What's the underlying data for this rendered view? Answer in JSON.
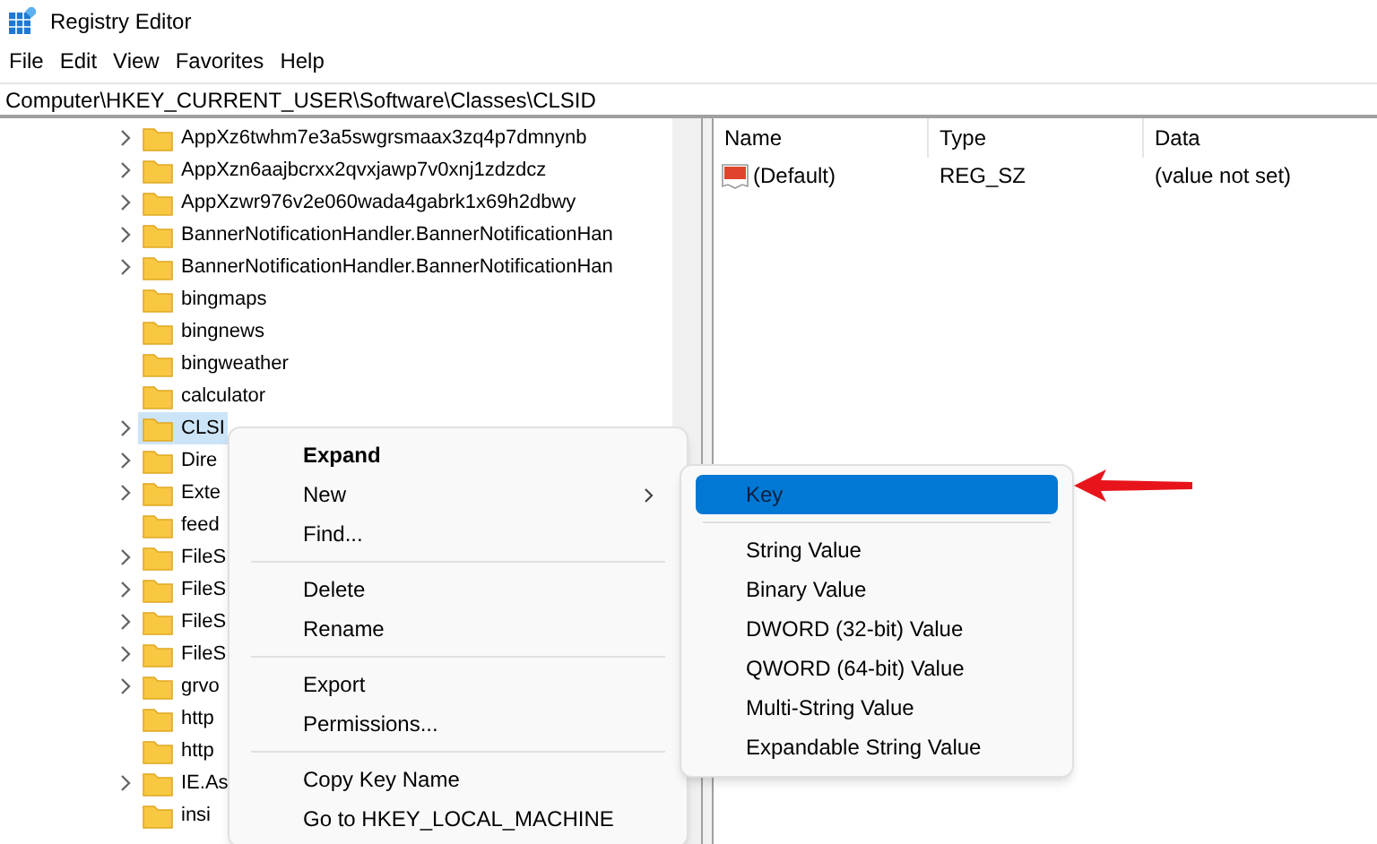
{
  "window": {
    "title": "Registry Editor"
  },
  "menu_bar": [
    "File",
    "Edit",
    "View",
    "Favorites",
    "Help"
  ],
  "address": "Computer\\HKEY_CURRENT_USER\\Software\\Classes\\CLSID",
  "tree": [
    {
      "label": "AppXz6twhm7e3a5swgrsmaax3zq4p7dmnynb",
      "has_children": true,
      "selected": false
    },
    {
      "label": "AppXzn6aajbcrxx2qvxjawp7v0xnj1zdzdcz",
      "has_children": true,
      "selected": false
    },
    {
      "label": "AppXzwr976v2e060wada4gabrk1x69h2dbwy",
      "has_children": true,
      "selected": false
    },
    {
      "label": "BannerNotificationHandler.BannerNotificationHan",
      "has_children": true,
      "selected": false
    },
    {
      "label": "BannerNotificationHandler.BannerNotificationHan",
      "has_children": true,
      "selected": false
    },
    {
      "label": "bingmaps",
      "has_children": false,
      "selected": false
    },
    {
      "label": "bingnews",
      "has_children": false,
      "selected": false
    },
    {
      "label": "bingweather",
      "has_children": false,
      "selected": false
    },
    {
      "label": "calculator",
      "has_children": false,
      "selected": false
    },
    {
      "label": "CLSI",
      "has_children": true,
      "selected": true
    },
    {
      "label": "Dire",
      "has_children": true,
      "selected": false
    },
    {
      "label": "Exte",
      "has_children": true,
      "selected": false
    },
    {
      "label": "feed",
      "has_children": false,
      "selected": false
    },
    {
      "label": "FileS",
      "has_children": true,
      "selected": false
    },
    {
      "label": "FileS",
      "has_children": true,
      "selected": false
    },
    {
      "label": "FileS",
      "has_children": true,
      "selected": false
    },
    {
      "label": "FileS",
      "has_children": true,
      "selected": false
    },
    {
      "label": "grvo",
      "has_children": true,
      "selected": false
    },
    {
      "label": "http",
      "has_children": false,
      "selected": false
    },
    {
      "label": "http",
      "has_children": false,
      "selected": false
    },
    {
      "label": "IE.As",
      "has_children": true,
      "selected": false
    },
    {
      "label": "insi",
      "has_children": false,
      "selected": false
    }
  ],
  "values_table": {
    "columns": [
      "Name",
      "Type",
      "Data"
    ],
    "rows": [
      {
        "name": "(Default)",
        "type": "REG_SZ",
        "data": "(value not set)"
      }
    ]
  },
  "context_menu": [
    {
      "kind": "item",
      "label": "Expand",
      "bold": true
    },
    {
      "kind": "submenu",
      "label": "New",
      "bold": false
    },
    {
      "kind": "item",
      "label": "Find...",
      "bold": false
    },
    {
      "kind": "separator"
    },
    {
      "kind": "item",
      "label": "Delete",
      "bold": false
    },
    {
      "kind": "item",
      "label": "Rename",
      "bold": false
    },
    {
      "kind": "separator"
    },
    {
      "kind": "item",
      "label": "Export",
      "bold": false
    },
    {
      "kind": "item",
      "label": "Permissions...",
      "bold": false
    },
    {
      "kind": "separator"
    },
    {
      "kind": "item",
      "label": "Copy Key Name",
      "bold": false
    },
    {
      "kind": "item",
      "label": "Go to HKEY_LOCAL_MACHINE",
      "bold": false
    }
  ],
  "submenu": [
    {
      "kind": "item",
      "label": "Key",
      "selected": true
    },
    {
      "kind": "separator"
    },
    {
      "kind": "item",
      "label": "String Value",
      "selected": false
    },
    {
      "kind": "item",
      "label": "Binary Value",
      "selected": false
    },
    {
      "kind": "item",
      "label": "DWORD (32-bit) Value",
      "selected": false
    },
    {
      "kind": "item",
      "label": "QWORD (64-bit) Value",
      "selected": false
    },
    {
      "kind": "item",
      "label": "Multi-String Value",
      "selected": false
    },
    {
      "kind": "item",
      "label": "Expandable String Value",
      "selected": false
    }
  ]
}
